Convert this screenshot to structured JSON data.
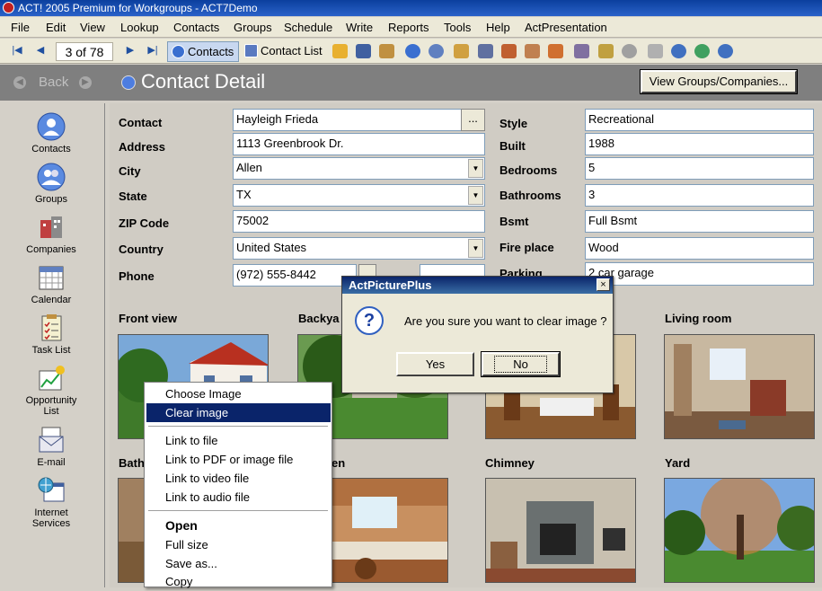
{
  "window": {
    "title": "ACT! 2005 Premium for Workgroups - ACT7Demo"
  },
  "menu": [
    "File",
    "Edit",
    "View",
    "Lookup",
    "Contacts",
    "Groups",
    "Schedule",
    "Write",
    "Reports",
    "Tools",
    "Help",
    "ActPresentation"
  ],
  "toolbar": {
    "record_count": "3 of 78",
    "contacts_label": "Contacts",
    "contact_list_label": "Contact List"
  },
  "header": {
    "back_label": "Back",
    "title": "Contact Detail",
    "view_groups_label": "View Groups/Companies..."
  },
  "sidebar": {
    "items": [
      {
        "label": "Contacts",
        "icon": "contacts-icon"
      },
      {
        "label": "Groups",
        "icon": "groups-icon"
      },
      {
        "label": "Companies",
        "icon": "companies-icon"
      },
      {
        "label": "Calendar",
        "icon": "calendar-icon"
      },
      {
        "label": "Task List",
        "icon": "task-list-icon"
      },
      {
        "label": "Opportunity List",
        "icon": "opportunity-icon"
      },
      {
        "label": "E-mail",
        "icon": "email-icon"
      },
      {
        "label": "Internet Services",
        "icon": "internet-icon"
      }
    ]
  },
  "form": {
    "contact": {
      "label": "Contact",
      "value": "Hayleigh Frieda"
    },
    "address": {
      "label": "Address",
      "value": "1113 Greenbrook Dr."
    },
    "city": {
      "label": "City",
      "value": "Allen"
    },
    "state": {
      "label": "State",
      "value": "TX"
    },
    "zip": {
      "label": "ZIP Code",
      "value": "75002"
    },
    "country": {
      "label": "Country",
      "value": "United States"
    },
    "phone": {
      "label": "Phone",
      "value": "(972) 555-8442"
    },
    "style": {
      "label": "Style",
      "value": "Recreational"
    },
    "built": {
      "label": "Built",
      "value": "1988"
    },
    "bedrooms": {
      "label": "Bedrooms",
      "value": "5"
    },
    "bathrooms": {
      "label": "Bathrooms",
      "value": "3"
    },
    "bsmt": {
      "label": "Bsmt",
      "value": "Full Bsmt"
    },
    "fireplace": {
      "label": "Fire place",
      "value": "Wood"
    },
    "parking": {
      "label": "Parking",
      "value": "2 car garage"
    }
  },
  "photos": {
    "front": "Front view",
    "back": "Backya",
    "living": "Living room",
    "bath": "Bath",
    "kitchen": "en",
    "chimney": "Chimney",
    "yard": "Yard"
  },
  "context_menu": {
    "choose_image": "Choose Image",
    "clear_image": "Clear image",
    "link_file": "Link to file",
    "link_pdf": "Link to PDF or image file",
    "link_video": "Link to video file",
    "link_audio": "Link to audio file",
    "open": "Open",
    "full_size": "Full size",
    "save_as": "Save as...",
    "copy": "Copy"
  },
  "dialog": {
    "title": "ActPicturePlus",
    "message": "Are you sure you want to clear image ?",
    "yes": "Yes",
    "no": "No",
    "close": "×"
  },
  "colors": {
    "titlebar": "#0b3f9e",
    "selection": "#0a246a",
    "header": "#7f7f7f"
  }
}
